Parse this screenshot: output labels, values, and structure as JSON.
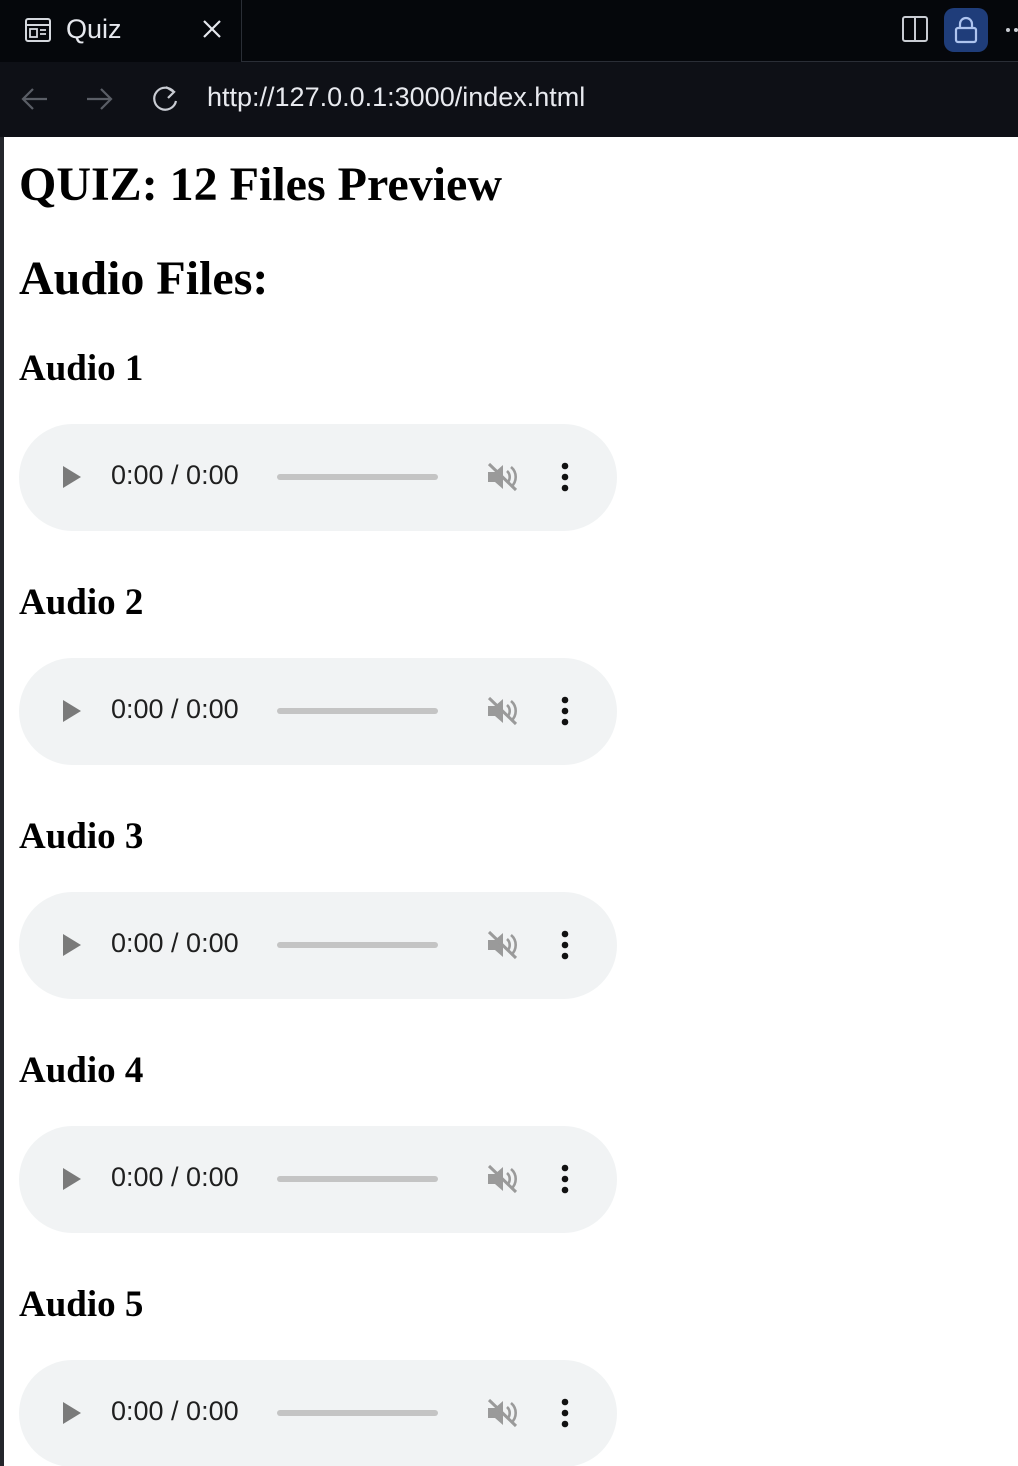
{
  "browser": {
    "tab_title": "Quiz",
    "url": "http://127.0.0.1:3000/index.html",
    "accent": "#1f3d7a"
  },
  "page": {
    "title": "QUIZ: 12 Files Preview",
    "section_title": "Audio Files:",
    "audio_items": [
      {
        "label": "Audio 1",
        "time": "0:00 / 0:00"
      },
      {
        "label": "Audio 2",
        "time": "0:00 / 0:00"
      },
      {
        "label": "Audio 3",
        "time": "0:00 / 0:00"
      },
      {
        "label": "Audio 4",
        "time": "0:00 / 0:00"
      },
      {
        "label": "Audio 5",
        "time": "0:00 / 0:00"
      }
    ]
  },
  "icons": {
    "tab": "page-layout-icon",
    "close": "close-icon",
    "split": "split-view-icon",
    "lock": "lock-icon",
    "more": "more-horizontal-icon",
    "back": "arrow-left-icon",
    "forward": "arrow-right-icon",
    "reload": "reload-icon",
    "play": "play-icon",
    "mute": "volume-muted-icon",
    "menu": "more-vertical-icon"
  }
}
